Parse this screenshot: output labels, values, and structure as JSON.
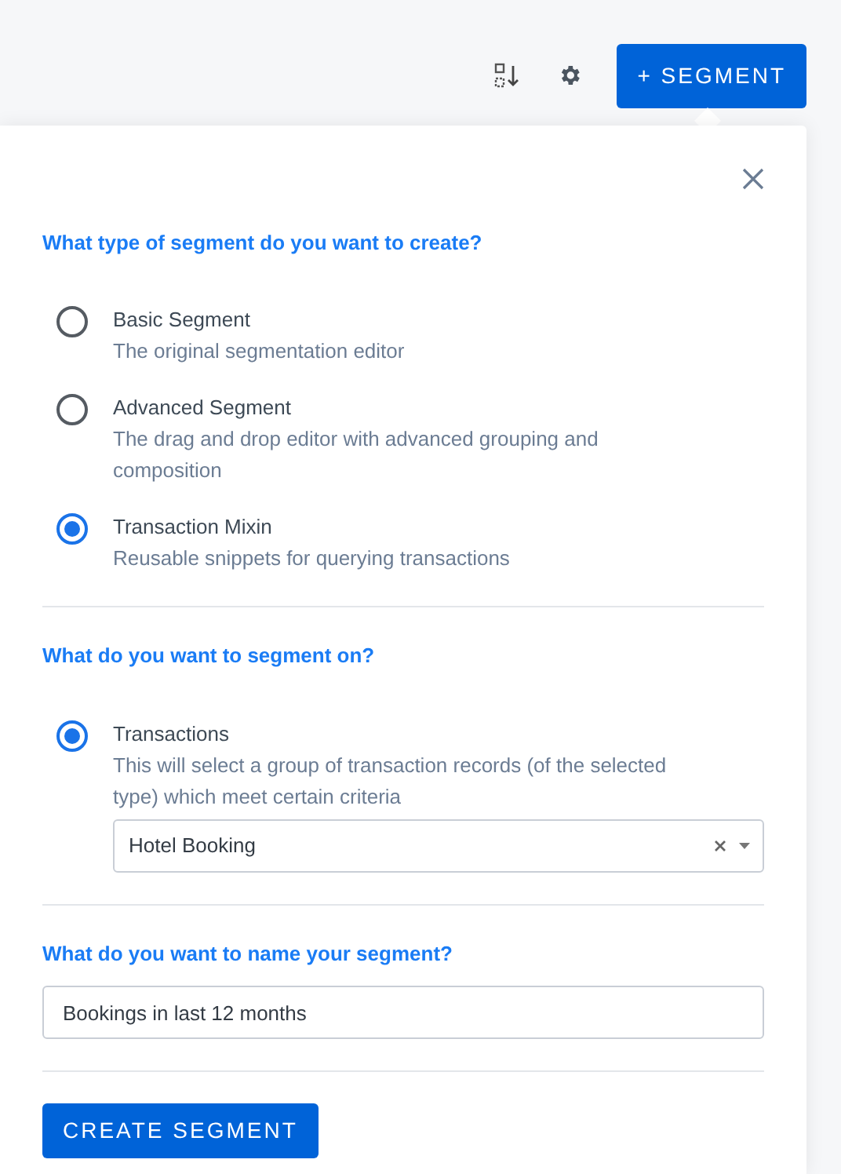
{
  "toolbar": {
    "add_button": "+ SEGMENT"
  },
  "sections": [
    {
      "heading": "What type of segment do you want to create?",
      "options": [
        {
          "label": "Basic Segment",
          "description": "The original segmentation editor",
          "selected": false
        },
        {
          "label": "Advanced Segment",
          "description": "The drag and drop editor with advanced grouping and composition",
          "selected": false
        },
        {
          "label": "Transaction Mixin",
          "description": "Reusable snippets for querying transactions",
          "selected": true
        }
      ]
    },
    {
      "heading": "What do you want to segment on?",
      "options": [
        {
          "label": "Transactions",
          "description": "This will select a group of transaction records (of the selected type) which meet certain criteria",
          "selected": true,
          "select_value": "Hotel Booking"
        }
      ]
    },
    {
      "heading": "What do you want to name your segment?",
      "input_value": "Bookings in last 12 months"
    }
  ],
  "submit_button": "CREATE SEGMENT"
}
